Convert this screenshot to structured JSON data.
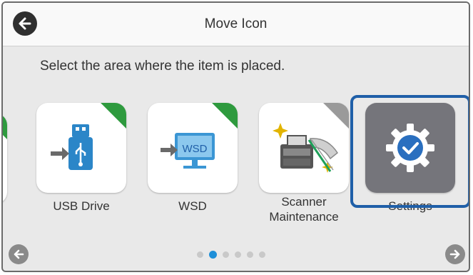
{
  "header": {
    "title": "Move Icon",
    "back_icon": "arrow-left-icon"
  },
  "instruction": "Select the area where the item is placed.",
  "tiles": [
    {
      "label": "USB Drive",
      "icon": "usb-drive-icon"
    },
    {
      "label": "WSD",
      "icon": "wsd-icon",
      "icon_text": "WSD"
    },
    {
      "label": "Scanner\nMaintenance",
      "icon": "scanner-maintenance-icon"
    },
    {
      "label": "Settings",
      "icon": "settings-gear-icon",
      "selected": true
    }
  ],
  "pagination": {
    "pages": 6,
    "current": 2
  },
  "nav": {
    "prev_icon": "arrow-left-icon",
    "next_icon": "arrow-right-icon"
  },
  "colors": {
    "accent_corner": "#2e9a3e",
    "selection_border": "#1f5fa8",
    "active_dot": "#1e8fd8",
    "settings_tile": "#75757b"
  }
}
